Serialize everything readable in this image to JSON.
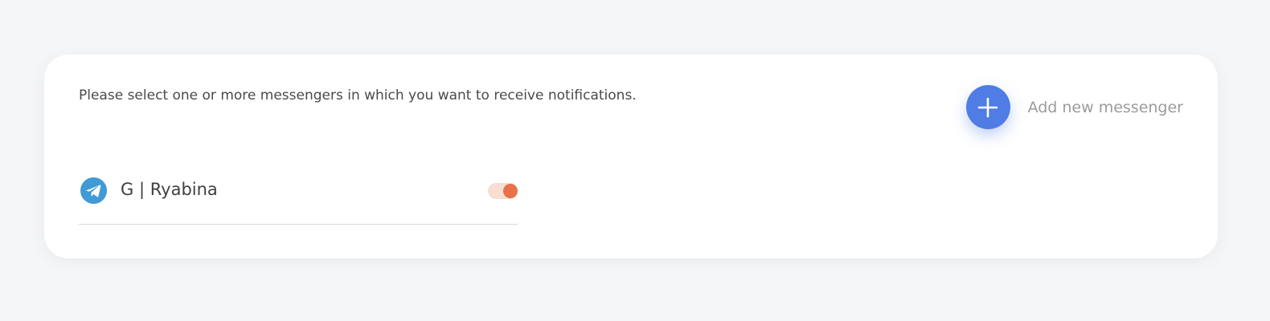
{
  "notifications": {
    "instruction": "Please select one or more messengers in which you want to receive notifications.",
    "add_messenger_label": "Add new messenger",
    "add_icon": "plus-icon",
    "accent_color": "#4f7de5",
    "messengers": [
      {
        "name": "G | Ryabina",
        "icon": "telegram-icon",
        "enabled": true,
        "toggle_color": "#e9714a"
      }
    ]
  }
}
